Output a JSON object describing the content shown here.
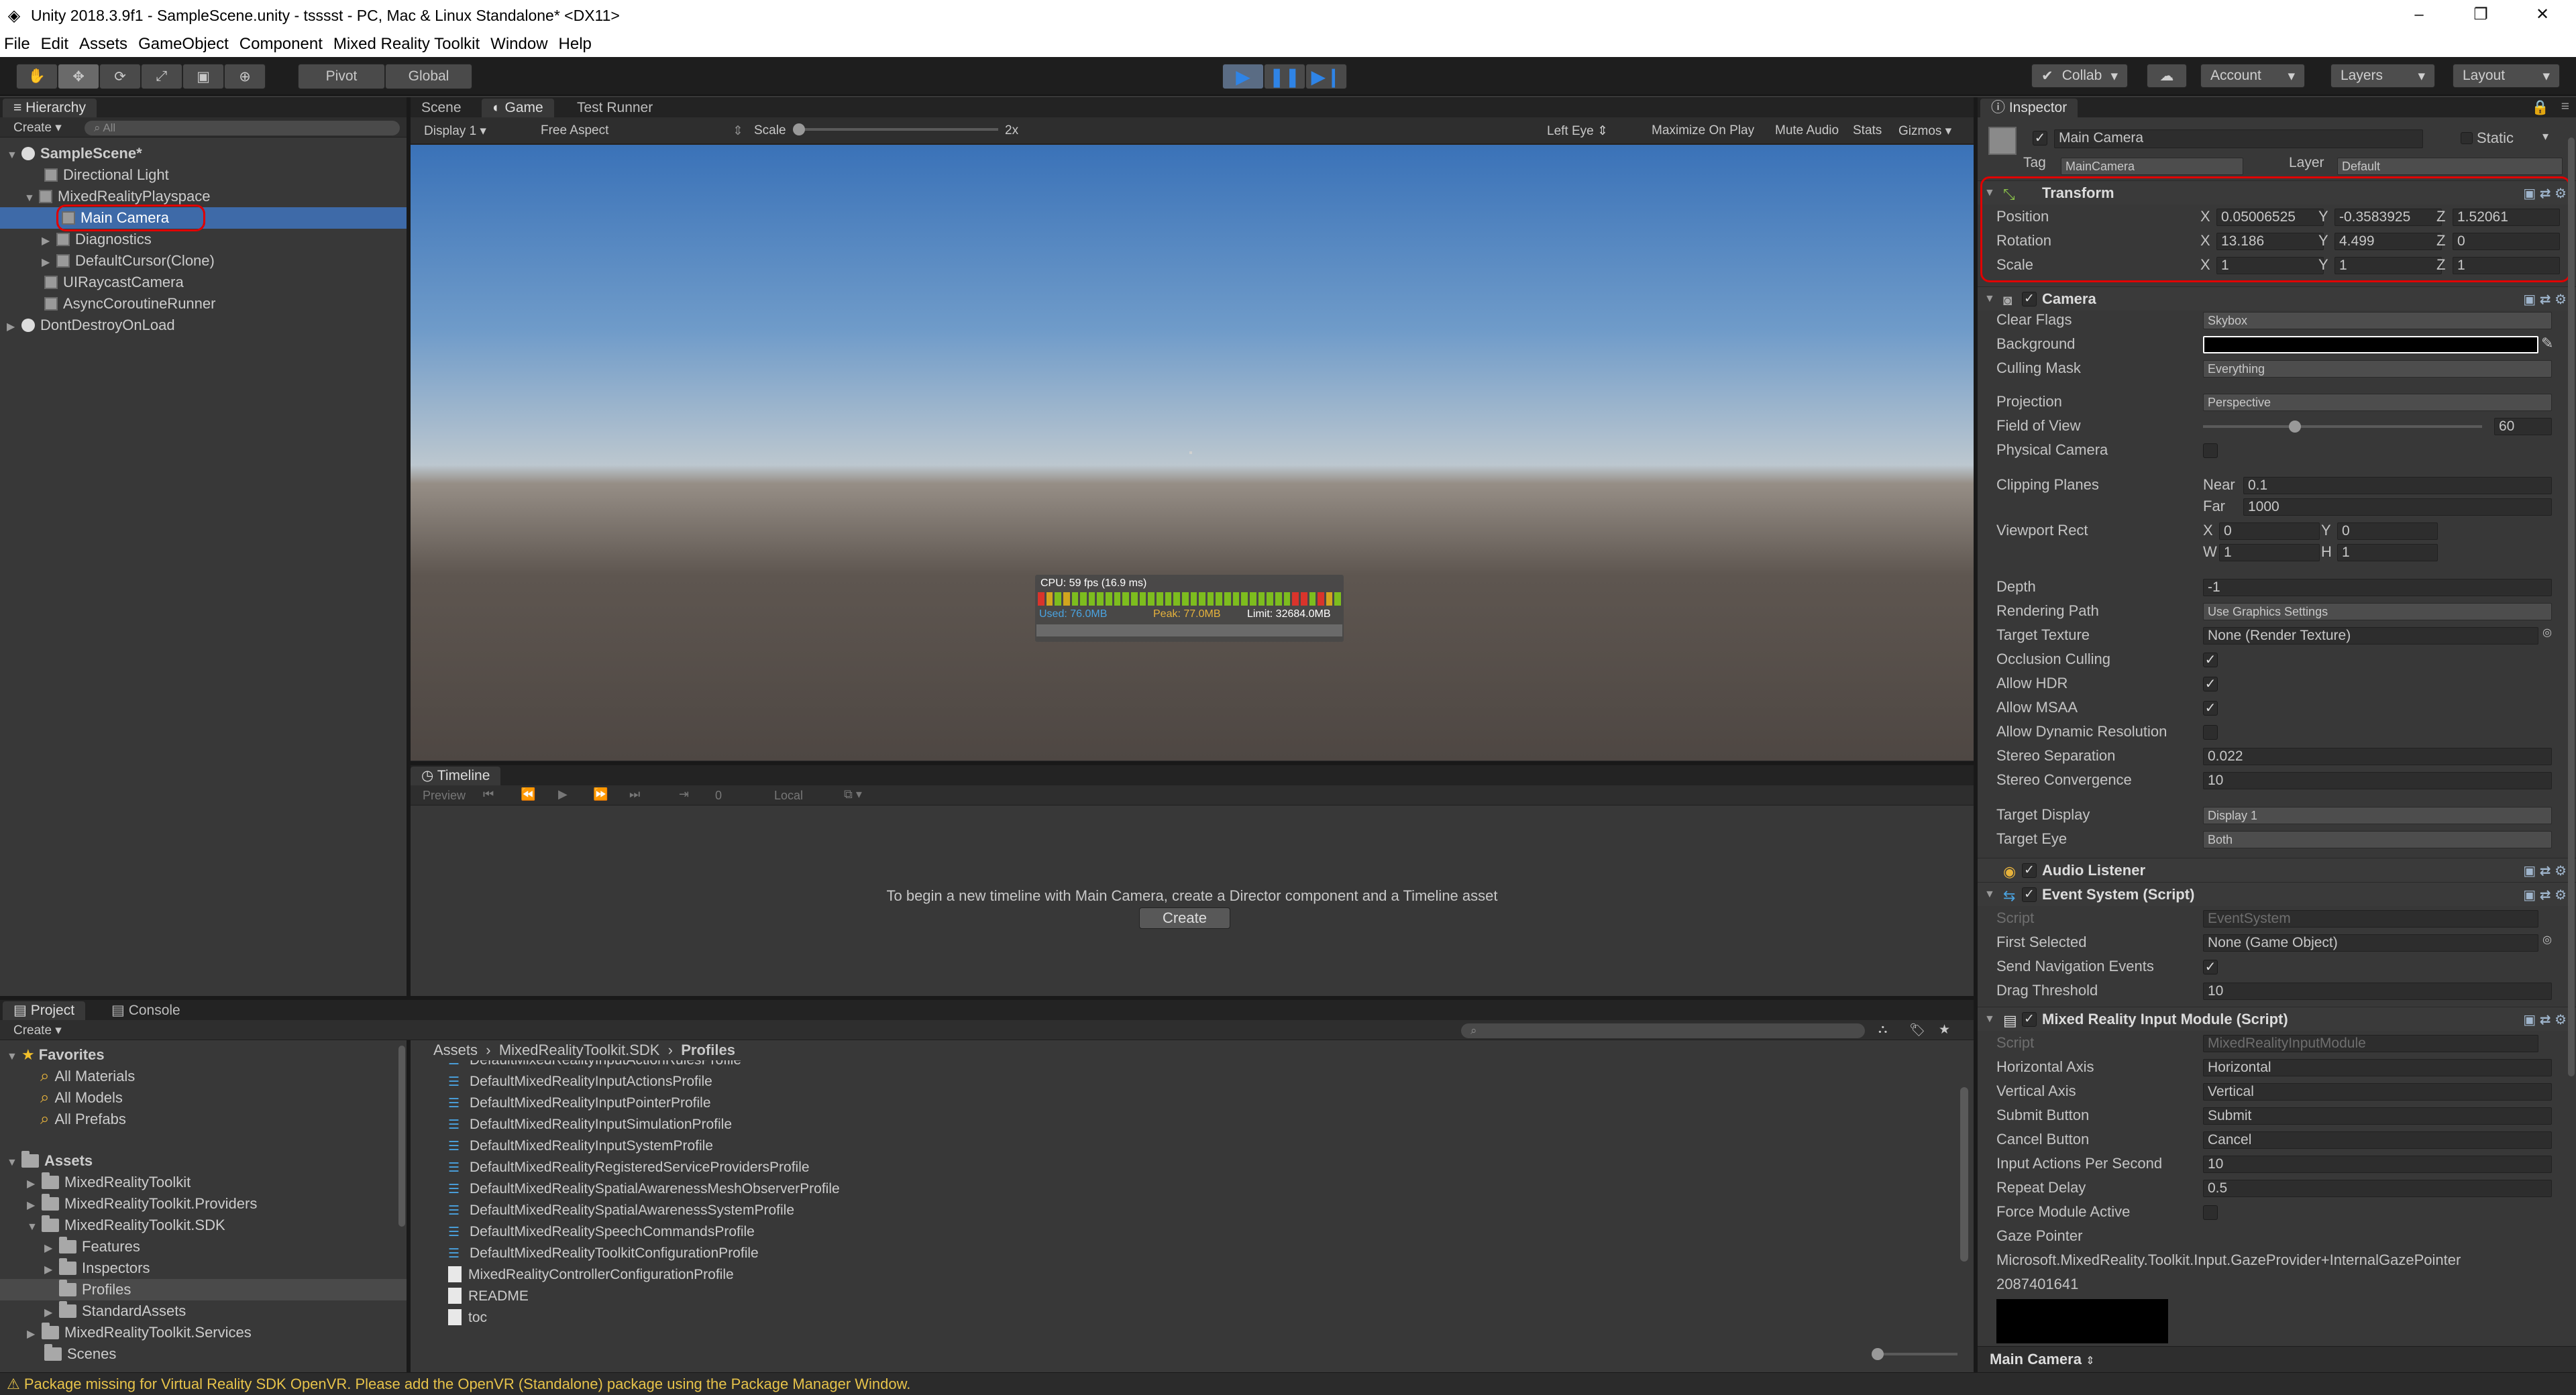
{
  "window": {
    "title": "Unity 2018.3.9f1 - SampleScene.unity - tsssst - PC, Mac & Linux Standalone* <DX11>",
    "controls": {
      "minimize": "–",
      "maximize": "❐",
      "close": "✕"
    }
  },
  "menu": [
    "File",
    "Edit",
    "Assets",
    "GameObject",
    "Component",
    "Mixed Reality Toolkit",
    "Window",
    "Help"
  ],
  "toolbar": {
    "pivot": "Pivot",
    "global": "Global",
    "collab": "Collab",
    "account": "Account",
    "layers": "Layers",
    "layout": "Layout",
    "accent_color": "#2f84e6"
  },
  "hierarchy": {
    "tab": "Hierarchy",
    "create": "Create",
    "search_placeholder": "All",
    "scene": "SampleScene*",
    "items": [
      {
        "label": "Directional Light"
      },
      {
        "label": "MixedRealityPlayspace"
      },
      {
        "label": "Main Camera"
      },
      {
        "label": "Diagnostics"
      },
      {
        "label": "DefaultCursor(Clone)"
      },
      {
        "label": "UIRaycastCamera"
      },
      {
        "label": "AsyncCoroutineRunner"
      }
    ],
    "dont_destroy": "DontDestroyOnLoad"
  },
  "scene_tabs": {
    "scene": "Scene",
    "game": "Game",
    "test_runner": "Test Runner"
  },
  "game_bar": {
    "display": "Display 1",
    "aspect": "Free Aspect",
    "scale_label": "Scale",
    "scale_value": "2x",
    "eye": "Left Eye",
    "maximize": "Maximize On Play",
    "mute": "Mute Audio",
    "stats": "Stats",
    "gizmos": "Gizmos"
  },
  "diagnostics": {
    "cpu": "CPU: 59 fps (16.9 ms)",
    "used": "Used: 76.0MB",
    "peak": "Peak: 77.0MB",
    "limit": "Limit: 32684.0MB"
  },
  "timeline": {
    "tab": "Timeline",
    "preview": "Preview",
    "frame": "0",
    "local": "Local",
    "message": "To begin a new timeline with Main Camera, create a Director component and a Timeline asset",
    "create": "Create"
  },
  "project": {
    "tab": "Project",
    "console_tab": "Console",
    "create": "Create",
    "favorites": "Favorites",
    "favorite_items": [
      "All Materials",
      "All Models",
      "All Prefabs"
    ],
    "assets_label": "Assets",
    "tree": [
      {
        "label": "MixedRealityToolkit"
      },
      {
        "label": "MixedRealityToolkit.Providers"
      },
      {
        "label": "MixedRealityToolkit.SDK"
      },
      {
        "label": "Features"
      },
      {
        "label": "Inspectors"
      },
      {
        "label": "Profiles"
      },
      {
        "label": "StandardAssets"
      },
      {
        "label": "MixedRealityToolkit.Services"
      },
      {
        "label": "Scenes"
      }
    ],
    "breadcrumb": [
      "Assets",
      "MixedRealityToolkit.SDK",
      "Profiles"
    ],
    "files": [
      "DefaultMixedRealityInputActionRulesProfile",
      "DefaultMixedRealityInputActionsProfile",
      "DefaultMixedRealityInputPointerProfile",
      "DefaultMixedRealityInputSimulationProfile",
      "DefaultMixedRealityInputSystemProfile",
      "DefaultMixedRealityRegisteredServiceProvidersProfile",
      "DefaultMixedRealitySpatialAwarenessMeshObserverProfile",
      "DefaultMixedRealitySpatialAwarenessSystemProfile",
      "DefaultMixedRealitySpeechCommandsProfile",
      "DefaultMixedRealityToolkitConfigurationProfile",
      "MixedRealityControllerConfigurationProfile",
      "README",
      "toc"
    ]
  },
  "inspector": {
    "tab": "Inspector",
    "object_name": "Main Camera",
    "static": "Static",
    "tag_label": "Tag",
    "tag": "MainCamera",
    "layer_label": "Layer",
    "layer": "Default",
    "transform": {
      "title": "Transform",
      "position_label": "Position",
      "pos": {
        "x": "0.05006525",
        "y": "-0.3583925",
        "z": "1.52061"
      },
      "rotation_label": "Rotation",
      "rot": {
        "x": "13.186",
        "y": "4.499",
        "z": "0"
      },
      "scale_label": "Scale",
      "scale": {
        "x": "1",
        "y": "1",
        "z": "1"
      }
    },
    "camera": {
      "title": "Camera",
      "clear_flags_label": "Clear Flags",
      "clear_flags": "Skybox",
      "background_label": "Background",
      "culling_mask_label": "Culling Mask",
      "culling_mask": "Everything",
      "projection_label": "Projection",
      "projection": "Perspective",
      "fov_label": "Field of View",
      "fov": "60",
      "fov_fraction": 0.33,
      "physical_label": "Physical Camera",
      "clipping_label": "Clipping Planes",
      "near_label": "Near",
      "near": "0.1",
      "far_label": "Far",
      "far": "1000",
      "viewport_label": "Viewport Rect",
      "vx": "0",
      "vy": "0",
      "vw": "1",
      "vh": "1",
      "depth_label": "Depth",
      "depth": "-1",
      "rendering_path_label": "Rendering Path",
      "rendering_path": "Use Graphics Settings",
      "target_texture_label": "Target Texture",
      "target_texture": "None (Render Texture)",
      "occlusion_label": "Occlusion Culling",
      "hdr_label": "Allow HDR",
      "msaa_label": "Allow MSAA",
      "dynres_label": "Allow Dynamic Resolution",
      "stereo_sep_label": "Stereo Separation",
      "stereo_sep": "0.022",
      "stereo_conv_label": "Stereo Convergence",
      "stereo_conv": "10",
      "target_display_label": "Target Display",
      "target_display": "Display 1",
      "target_eye_label": "Target Eye",
      "target_eye": "Both"
    },
    "audio_listener": {
      "title": "Audio Listener"
    },
    "event_system": {
      "title": "Event System (Script)",
      "script_label": "Script",
      "script": "EventSystem",
      "first_selected_label": "First Selected",
      "first_selected": "None (Game Object)",
      "send_nav_label": "Send Navigation Events",
      "drag_label": "Drag Threshold",
      "drag": "10"
    },
    "input_module": {
      "title": "Mixed Reality Input Module (Script)",
      "script_label": "Script",
      "script": "MixedRealityInputModule",
      "h_axis_label": "Horizontal Axis",
      "h_axis": "Horizontal",
      "v_axis_label": "Vertical Axis",
      "v_axis": "Vertical",
      "submit_label": "Submit Button",
      "submit": "Submit",
      "cancel_label": "Cancel Button",
      "cancel": "Cancel",
      "apps_label": "Input Actions Per Second",
      "apps": "10",
      "repeat_label": "Repeat Delay",
      "repeat": "0.5",
      "force_label": "Force Module Active",
      "gaze_label": "Gaze Pointer",
      "gaze_value": "Microsoft.MixedReality.Toolkit.Input.GazeProvider+InternalGazePointer",
      "gaze_id": "2087401641"
    },
    "footer": "Main Camera"
  },
  "status": "Package missing for Virtual Reality SDK OpenVR. Please add the OpenVR (Standalone) package using the Package Manager Window."
}
